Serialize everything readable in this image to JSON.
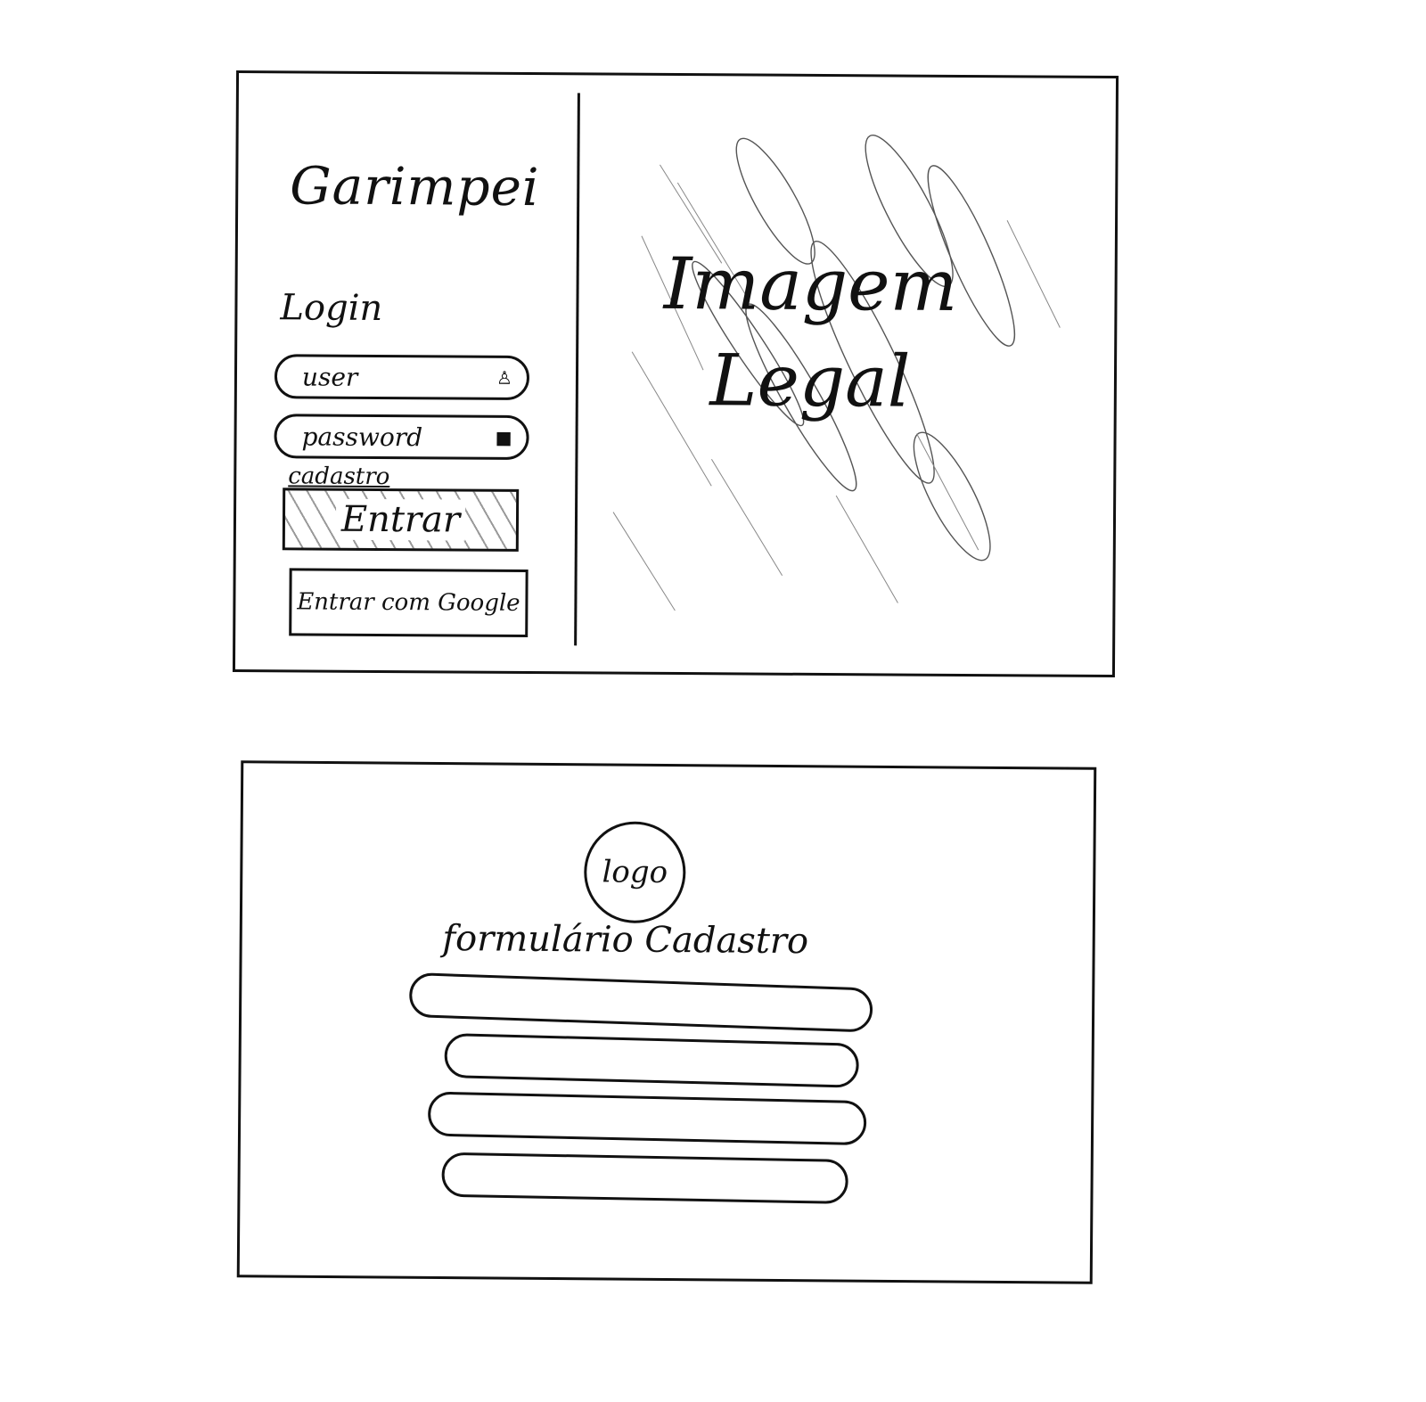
{
  "login_screen": {
    "brand_title": "Garimpei",
    "heading": "Login",
    "user_field": {
      "placeholder": "user",
      "icon": "user-icon"
    },
    "password_field": {
      "placeholder": "password",
      "icon": "lock-icon"
    },
    "signup_link": "cadastro",
    "enter_button": "Entrar",
    "google_button": "Entrar com Google",
    "image_caption": "Imagem Legal"
  },
  "signup_screen": {
    "logo_text": "logo",
    "form_title": "formulário Cadastro",
    "field_count": 4
  }
}
